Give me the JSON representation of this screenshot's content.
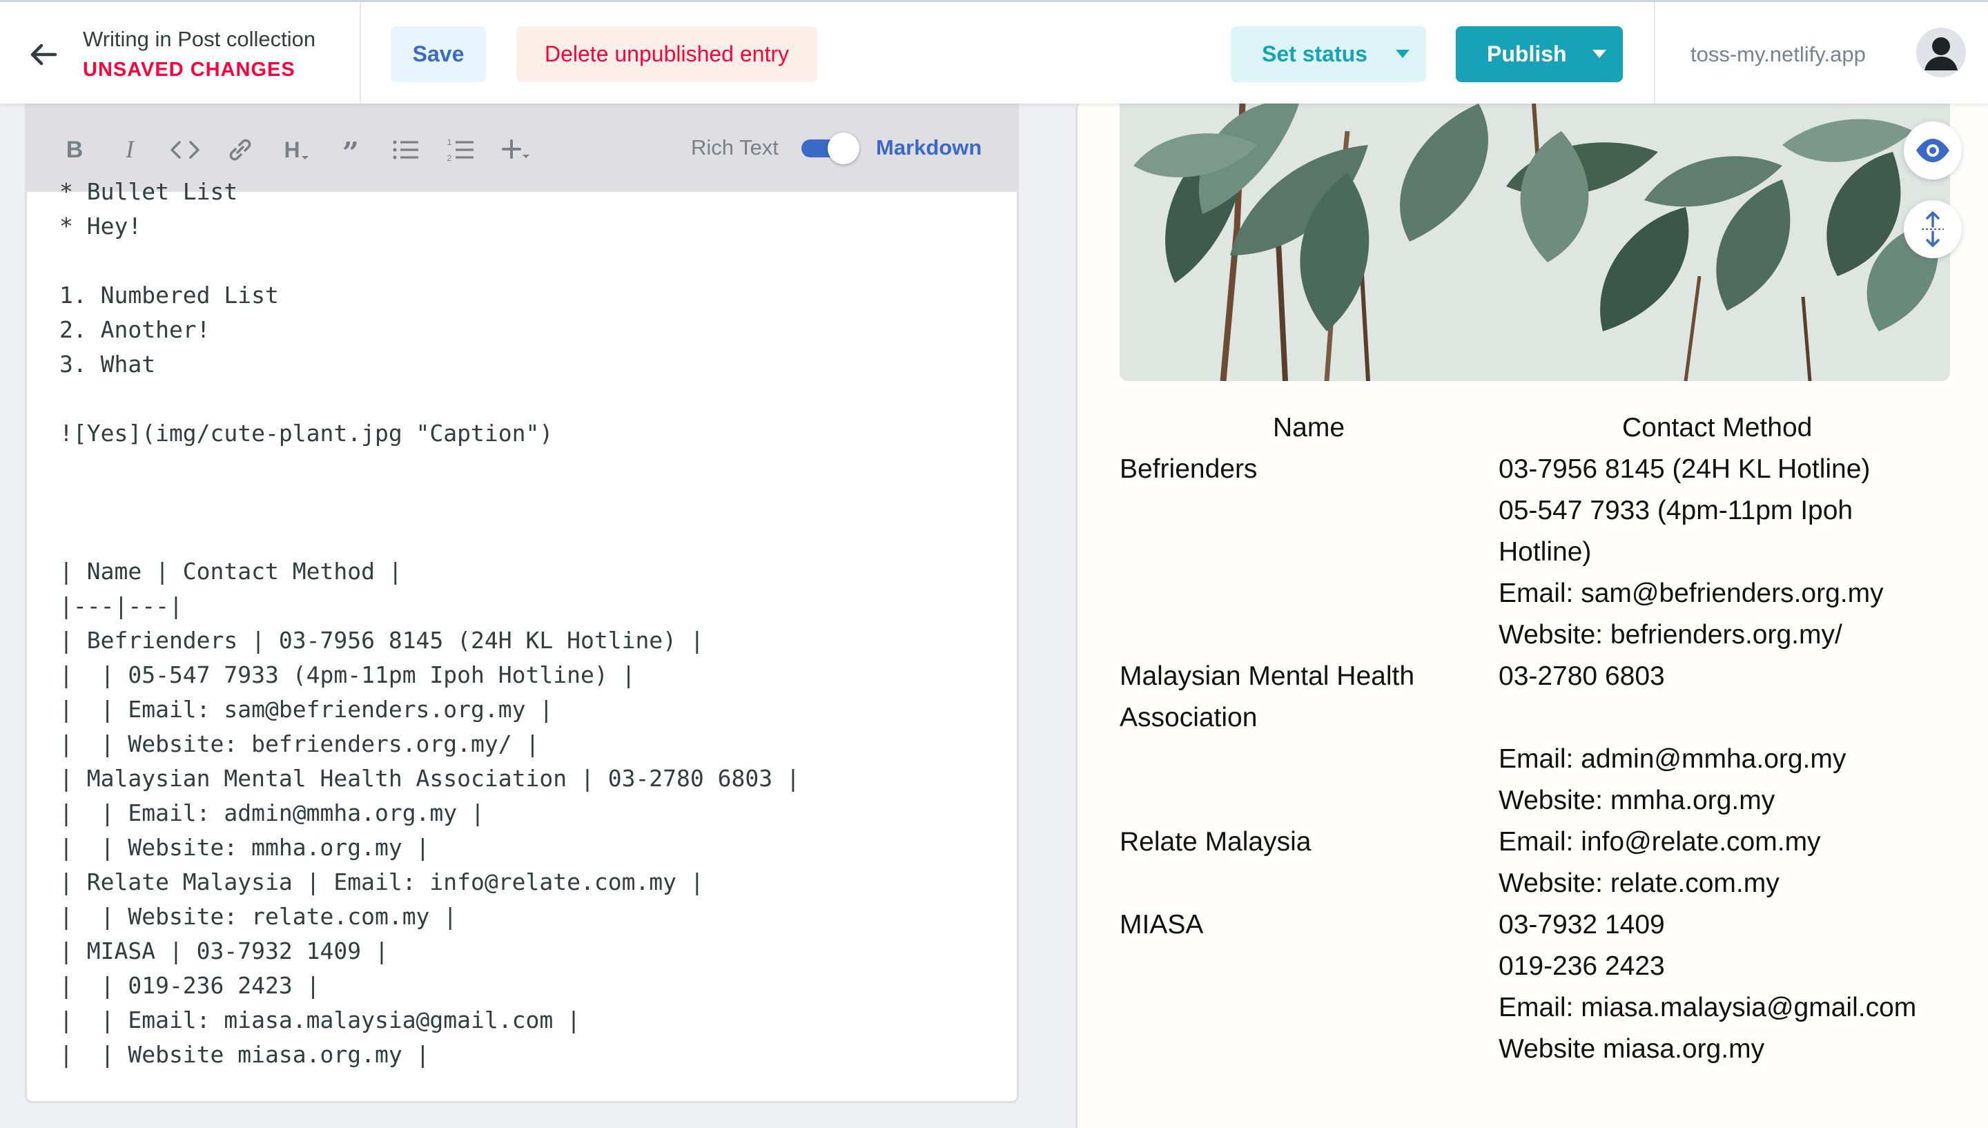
{
  "header": {
    "breadcrumb_title": "Writing in Post collection",
    "status": "UNSAVED CHANGES",
    "save_label": "Save",
    "delete_label": "Delete unpublished entry",
    "set_status_label": "Set status",
    "publish_label": "Publish",
    "site_url": "toss-my.netlify.app",
    "icons": {
      "back": "arrow-left-icon",
      "avatar": "user-avatar-icon"
    }
  },
  "editor": {
    "toolbar": [
      "bold-icon",
      "italic-icon",
      "code-icon",
      "link-icon",
      "heading-icon",
      "quote-icon",
      "bulleted-list-icon",
      "numbered-list-icon",
      "add-component-icon"
    ],
    "mode_rich_text": "Rich Text",
    "mode_markdown": "Markdown",
    "markdown_active": true,
    "lines": [
      "* Bullet List",
      "* Hey!",
      "",
      "1. Numbered List",
      "2. Another!",
      "3. What",
      "",
      "![Yes](img/cute-plant.jpg \"Caption\")",
      "",
      "",
      "",
      "| Name | Contact Method |",
      "|---|---|",
      "| Befrienders | 03-7956 8145 (24H KL Hotline) |",
      "|  | 05-547 7933 (4pm-11pm Ipoh Hotline) |",
      "|  | Email: sam@befrienders.org.my |",
      "|  | Website: befrienders.org.my/ |",
      "| Malaysian Mental Health Association | 03-2780 6803 |",
      "|  | Email: admin@mmha.org.my |",
      "|  | Website: mmha.org.my |",
      "| Relate Malaysia | Email: info@relate.com.my |",
      "|  | Website: relate.com.my |",
      "| MIASA | 03-7932 1409 |",
      "|  | 019-236 2423 |",
      "|  | Email: miasa.malaysia@gmail.com |",
      "|  | Website miasa.org.my |"
    ]
  },
  "preview": {
    "image_subject": "rubber plant leaves",
    "icons": {
      "toggle_preview": "eye-icon",
      "sync_scroll": "scroll-sync-icon"
    },
    "table": {
      "headers": [
        "Name",
        "Contact Method"
      ],
      "rows": [
        [
          "Befrienders",
          "03-7956 8145 (24H KL Hotline)"
        ],
        [
          "",
          "05-547 7933 (4pm-11pm Ipoh"
        ],
        [
          "",
          "Hotline)"
        ],
        [
          "",
          "Email: sam@befrienders.org.my"
        ],
        [
          "",
          "Website: befrienders.org.my/"
        ],
        [
          "Malaysian Mental Health",
          "03-2780 6803"
        ],
        [
          "Association",
          ""
        ],
        [
          "",
          "Email: admin@mmha.org.my"
        ],
        [
          "",
          "Website: mmha.org.my"
        ],
        [
          "Relate Malaysia",
          "Email: info@relate.com.my"
        ],
        [
          "",
          "Website: relate.com.my"
        ],
        [
          "MIASA",
          "03-7932 1409"
        ],
        [
          "",
          "019-236 2423"
        ],
        [
          "",
          "Email: miasa.malaysia@gmail.com"
        ],
        [
          "",
          "Website miasa.org.my"
        ]
      ]
    }
  },
  "colors": {
    "accent": "#3a69c7",
    "publish": "#17a2b8",
    "danger": "#ff003b"
  }
}
